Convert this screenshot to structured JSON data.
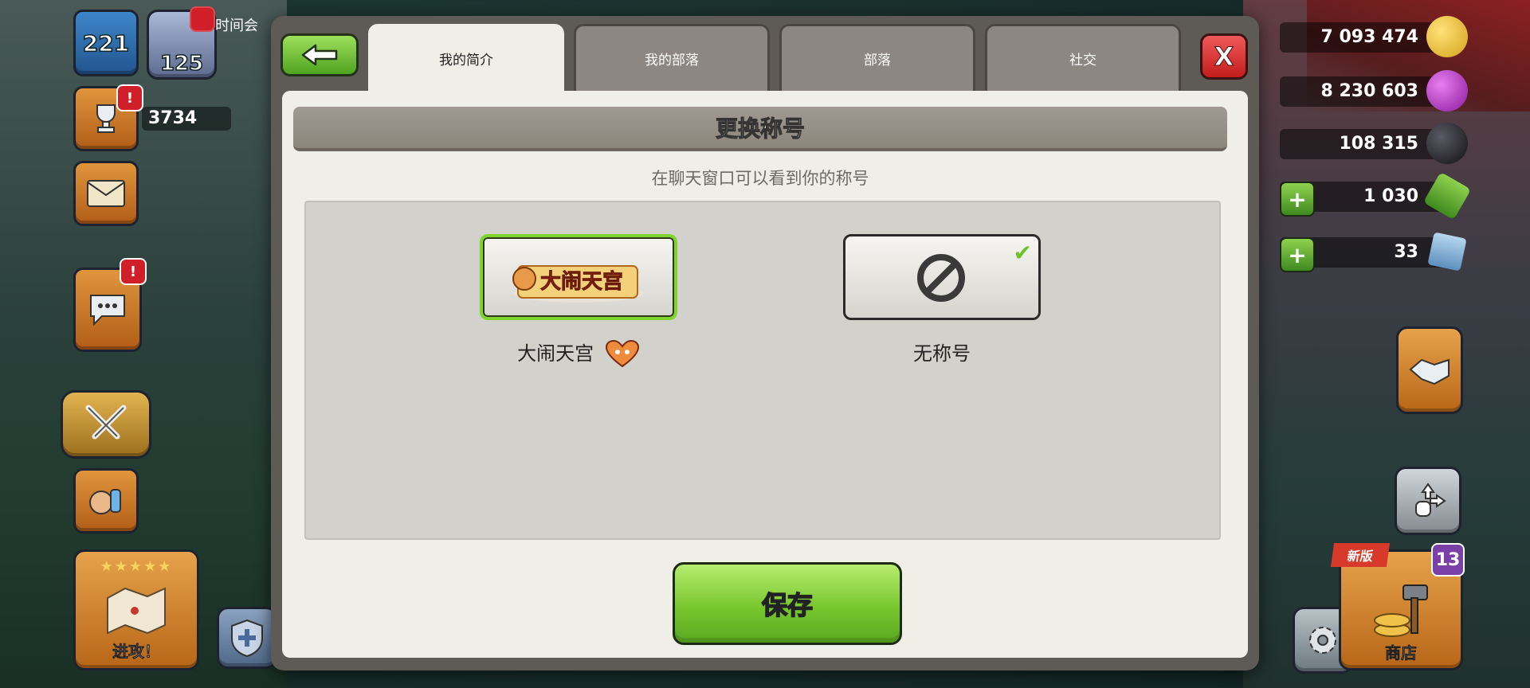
{
  "hud": {
    "level": "221",
    "league_level": "125",
    "time_text": "时间会",
    "trophies": "3734",
    "trophy_notif": "!",
    "chat_notif": "!",
    "attack_label": "进攻！",
    "attack_stars": "★★★★★",
    "gold": "7 093 474",
    "elixir": "8 230 603",
    "dark_elixir": "108 315",
    "gems": "1 030",
    "tickets": "33",
    "shop_label": "商店",
    "shop_new": "新版",
    "shop_count": "13"
  },
  "modal": {
    "tabs": [
      "我的简介",
      "我的部落",
      "部落",
      "社交"
    ],
    "active_tab": 0,
    "close_label": "X",
    "title": "更换称号",
    "subtitle": "在聊天窗口可以看到你的称号",
    "titles": [
      {
        "label": "大闹天宫",
        "selected": true,
        "banner_text": "大闹天宫"
      },
      {
        "label": "无称号",
        "selected": false,
        "checked": true
      }
    ],
    "save_label": "保存"
  },
  "colors": {
    "accent_green": "#7fd52e",
    "close_red": "#c41c1c",
    "modal_bg": "#efeee7"
  }
}
